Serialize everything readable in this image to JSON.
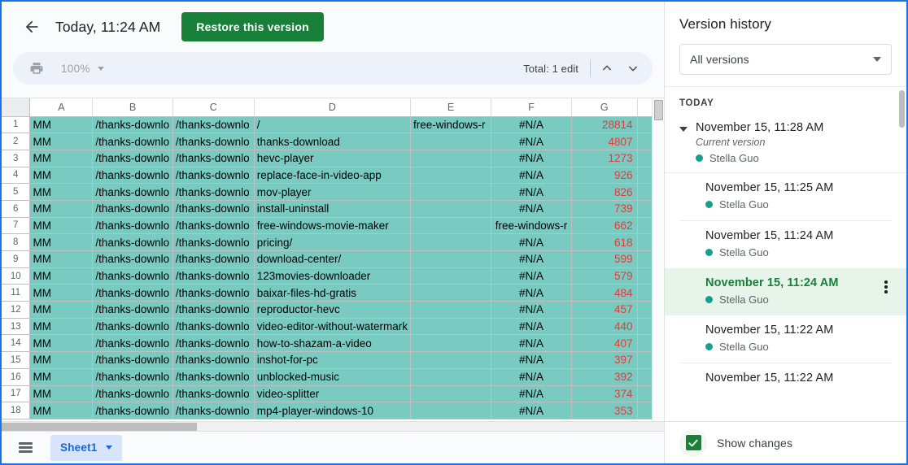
{
  "topbar": {
    "back_icon": "arrow-left-icon",
    "doc_time": "Today, 11:24 AM",
    "restore_label": "Restore this version"
  },
  "toolbar": {
    "print_icon": "print-icon",
    "zoom_value": "100%",
    "total_edits": "Total: 1 edit",
    "prev_icon": "chevron-up-icon",
    "next_icon": "chevron-down-icon"
  },
  "sheet": {
    "columns": [
      "A",
      "B",
      "C",
      "D",
      "E",
      "F",
      "G"
    ],
    "rows": [
      {
        "n": "1",
        "A": "MM",
        "B": "/thanks-downlo",
        "C": "/thanks-downlo",
        "D": "/",
        "E": "free-windows-r",
        "F": "#N/A",
        "G": "28814"
      },
      {
        "n": "2",
        "A": "MM",
        "B": "/thanks-downlo",
        "C": "/thanks-downlo",
        "D": "thanks-download",
        "E": "",
        "F": "#N/A",
        "G": "4807"
      },
      {
        "n": "3",
        "A": "MM",
        "B": "/thanks-downlo",
        "C": "/thanks-downlo",
        "D": "hevc-player",
        "E": "",
        "F": "#N/A",
        "G": "1273"
      },
      {
        "n": "4",
        "A": "MM",
        "B": "/thanks-downlo",
        "C": "/thanks-downlo",
        "D": "replace-face-in-video-app",
        "E": "",
        "F": "#N/A",
        "G": "926"
      },
      {
        "n": "5",
        "A": "MM",
        "B": "/thanks-downlo",
        "C": "/thanks-downlo",
        "D": "mov-player",
        "E": "",
        "F": "#N/A",
        "G": "826"
      },
      {
        "n": "6",
        "A": "MM",
        "B": "/thanks-downlo",
        "C": "/thanks-downlo",
        "D": "install-uninstall",
        "E": "",
        "F": "#N/A",
        "G": "739"
      },
      {
        "n": "7",
        "A": "MM",
        "B": "/thanks-downlo",
        "C": "/thanks-downlo",
        "D": "free-windows-movie-maker",
        "E": "",
        "F": "free-windows-r",
        "G": "662"
      },
      {
        "n": "8",
        "A": "MM",
        "B": "/thanks-downlo",
        "C": "/thanks-downlo",
        "D": "pricing/",
        "E": "",
        "F": "#N/A",
        "G": "618"
      },
      {
        "n": "9",
        "A": "MM",
        "B": "/thanks-downlo",
        "C": "/thanks-downlo",
        "D": "download-center/",
        "E": "",
        "F": "#N/A",
        "G": "599"
      },
      {
        "n": "10",
        "A": "MM",
        "B": "/thanks-downlo",
        "C": "/thanks-downlo",
        "D": "123movies-downloader",
        "E": "",
        "F": "#N/A",
        "G": "579"
      },
      {
        "n": "11",
        "A": "MM",
        "B": "/thanks-downlo",
        "C": "/thanks-downlo",
        "D": "baixar-files-hd-gratis",
        "E": "",
        "F": "#N/A",
        "G": "484"
      },
      {
        "n": "12",
        "A": "MM",
        "B": "/thanks-downlo",
        "C": "/thanks-downlo",
        "D": "reproductor-hevc",
        "E": "",
        "F": "#N/A",
        "G": "457"
      },
      {
        "n": "13",
        "A": "MM",
        "B": "/thanks-downlo",
        "C": "/thanks-downlo",
        "D": "video-editor-without-watermark",
        "E": "",
        "F": "#N/A",
        "G": "440"
      },
      {
        "n": "14",
        "A": "MM",
        "B": "/thanks-downlo",
        "C": "/thanks-downlo",
        "D": "how-to-shazam-a-video",
        "E": "",
        "F": "#N/A",
        "G": "407"
      },
      {
        "n": "15",
        "A": "MM",
        "B": "/thanks-downlo",
        "C": "/thanks-downlo",
        "D": "inshot-for-pc",
        "E": "",
        "F": "#N/A",
        "G": "397"
      },
      {
        "n": "16",
        "A": "MM",
        "B": "/thanks-downlo",
        "C": "/thanks-downlo",
        "D": "unblocked-music",
        "E": "",
        "F": "#N/A",
        "G": "392"
      },
      {
        "n": "17",
        "A": "MM",
        "B": "/thanks-downlo",
        "C": "/thanks-downlo",
        "D": "video-splitter",
        "E": "",
        "F": "#N/A",
        "G": "374"
      },
      {
        "n": "18",
        "A": "MM",
        "B": "/thanks-downlo",
        "C": "/thanks-downlo",
        "D": "mp4-player-windows-10",
        "E": "",
        "F": "#N/A",
        "G": "353"
      }
    ],
    "highlight_color": "#79cbc2",
    "number_color": "#e53935"
  },
  "sheetbar": {
    "all_sheets_icon": "hamburger-icon",
    "tab_label": "Sheet1",
    "tab_caret_icon": "chevron-down-icon"
  },
  "version_history": {
    "title": "Version history",
    "filter_value": "All versions",
    "group_label": "TODAY",
    "items": [
      {
        "date": "November 15, 11:28 AM",
        "sub": "Current version",
        "author": "Stella Guo",
        "current": true,
        "selected": false
      },
      {
        "date": "November 15, 11:25 AM",
        "sub": "",
        "author": "Stella Guo",
        "current": false,
        "selected": false
      },
      {
        "date": "November 15, 11:24 AM",
        "sub": "",
        "author": "Stella Guo",
        "current": false,
        "selected": false
      },
      {
        "date": "November 15, 11:24 AM",
        "sub": "",
        "author": "Stella Guo",
        "current": false,
        "selected": true
      },
      {
        "date": "November 15, 11:22 AM",
        "sub": "",
        "author": "Stella Guo",
        "current": false,
        "selected": false
      },
      {
        "date": "November 15, 11:22 AM",
        "sub": "",
        "author": "",
        "current": false,
        "selected": false
      }
    ],
    "selected_accent": "#188038",
    "author_dot_color": "#16a08b",
    "show_changes_label": "Show changes",
    "show_changes_checked": true,
    "kebab_icon": "more-vert-icon"
  }
}
